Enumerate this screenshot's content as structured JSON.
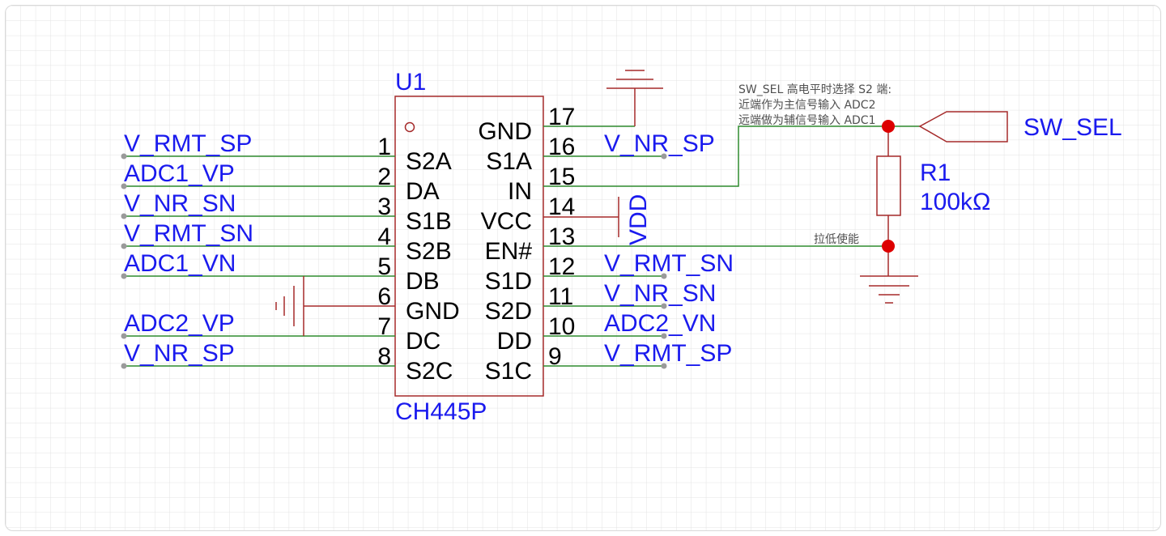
{
  "component": {
    "ref": "U1",
    "part": "CH445P",
    "left_pins": [
      {
        "num": "1",
        "name": "S2A",
        "net": "V_RMT_SP"
      },
      {
        "num": "2",
        "name": "DA",
        "net": "ADC1_VP"
      },
      {
        "num": "3",
        "name": "S1B",
        "net": "V_NR_SN"
      },
      {
        "num": "4",
        "name": "S2B",
        "net": "V_RMT_SN"
      },
      {
        "num": "5",
        "name": "DB",
        "net": "ADC1_VN"
      },
      {
        "num": "6",
        "name": "GND",
        "net": ""
      },
      {
        "num": "7",
        "name": "DC",
        "net": "ADC2_VP"
      },
      {
        "num": "8",
        "name": "S2C",
        "net": "V_NR_SP"
      }
    ],
    "right_pins": [
      {
        "num": "17",
        "name": "GND",
        "net": ""
      },
      {
        "num": "16",
        "name": "S1A",
        "net": "V_NR_SP"
      },
      {
        "num": "15",
        "name": "IN",
        "net": ""
      },
      {
        "num": "14",
        "name": "VCC",
        "net": ""
      },
      {
        "num": "13",
        "name": "EN#",
        "net": ""
      },
      {
        "num": "12",
        "name": "S1D",
        "net": "V_RMT_SN"
      },
      {
        "num": "11",
        "name": "S2D",
        "net": "V_NR_SN"
      },
      {
        "num": "10",
        "name": "DD",
        "net": "ADC2_VN"
      },
      {
        "num": "9",
        "name": "S1C",
        "net": "V_RMT_SP"
      }
    ]
  },
  "power_label": "VDD",
  "resistor": {
    "ref": "R1",
    "value": "100kΩ"
  },
  "port": {
    "label": "SW_SEL"
  },
  "notes": {
    "sel_line1": "SW_SEL 高电平时选择 S2 端:",
    "sel_line2": "近端作为主信号输入 ADC2",
    "sel_line3": "远端做为辅信号输入 ADC1",
    "en_note": "拉低使能"
  },
  "colors": {
    "wire": "#2e8b2e",
    "symbol": "#a52a2a",
    "net_label": "#1a1aee",
    "junction": "#dd0000",
    "grid": "#e3e3e3"
  }
}
